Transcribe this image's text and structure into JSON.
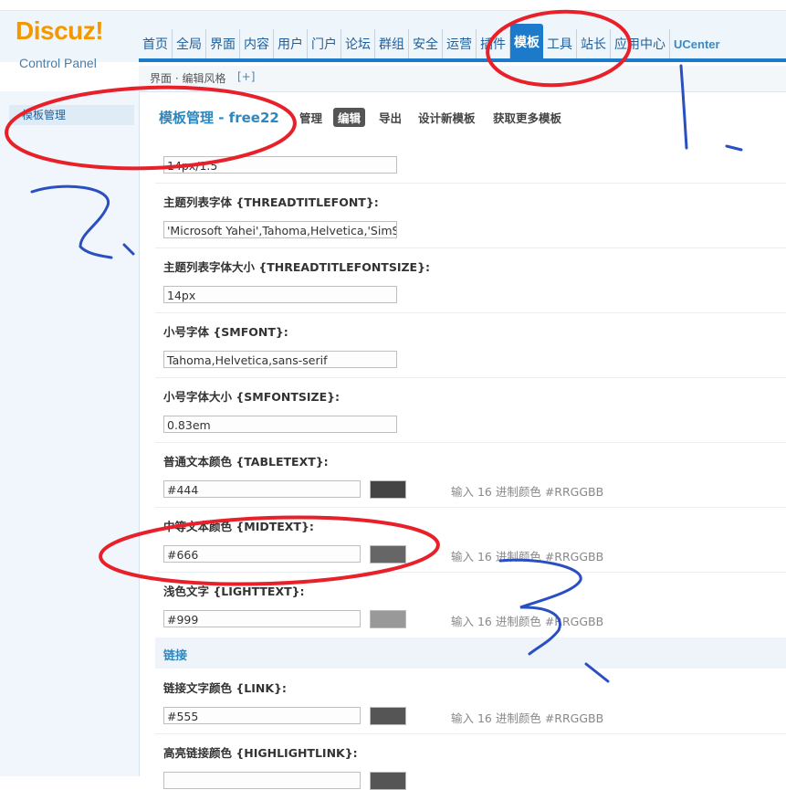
{
  "logo": {
    "brand": "Discuz!",
    "subtitle": "Control Panel"
  },
  "nav": {
    "items": [
      "首页",
      "全局",
      "界面",
      "内容",
      "用户",
      "门户",
      "论坛",
      "群组",
      "安全",
      "运营",
      "插件",
      "模板",
      "工具",
      "站长",
      "应用中心",
      "UCenter"
    ],
    "active_index": 11
  },
  "breadcrumb": {
    "path": "界面 · 编辑风格",
    "add": "[+]"
  },
  "sidebar": {
    "items": [
      "模板管理"
    ]
  },
  "page": {
    "title": "模板管理 - free22",
    "tabs": [
      "管理",
      "编辑",
      "导出",
      "设计新模板",
      "获取更多模板"
    ],
    "active_tab": "编辑"
  },
  "fields": [
    {
      "label": "",
      "value": "14px/1.5"
    },
    {
      "label": "主题列表字体 {THREADTITLEFONT}:",
      "value": "'Microsoft Yahei',Tahoma,Helvetica,'SimSun'"
    },
    {
      "label": "主题列表字体大小 {THREADTITLEFONTSIZE}:",
      "value": "14px"
    },
    {
      "label": "小号字体 {SMFONT}:",
      "value": "Tahoma,Helvetica,sans-serif"
    },
    {
      "label": "小号字体大小 {SMFONTSIZE}:",
      "value": "0.83em"
    },
    {
      "label": "普通文本颜色 {TABLETEXT}:",
      "value": "#444",
      "swatch": "#444444",
      "hint": "输入 16 进制颜色 #RRGGBB"
    },
    {
      "label": "中等文本颜色 {MIDTEXT}:",
      "value": "#666",
      "swatch": "#666666",
      "hint": "输入 16 进制颜色 #RRGGBB"
    },
    {
      "label": "浅色文字 {LIGHTTEXT}:",
      "value": "#999",
      "swatch": "#999999",
      "hint": "输入 16 进制颜色 #RRGGBB"
    },
    {
      "label": "链接文字颜色 {LINK}:",
      "value": "#555",
      "swatch": "#555555",
      "hint": "输入 16 进制颜色 #RRGGBB"
    },
    {
      "label": "高亮链接颜色 {HIGHLIGHTLINK}:",
      "value": "",
      "swatch": "#555555",
      "hint": ""
    }
  ],
  "section_link": "链接",
  "colors": {
    "accent": "#1b7ac9",
    "logo": "#f39800",
    "annotation_red": "#e8202a",
    "annotation_blue": "#2a4fc0"
  }
}
